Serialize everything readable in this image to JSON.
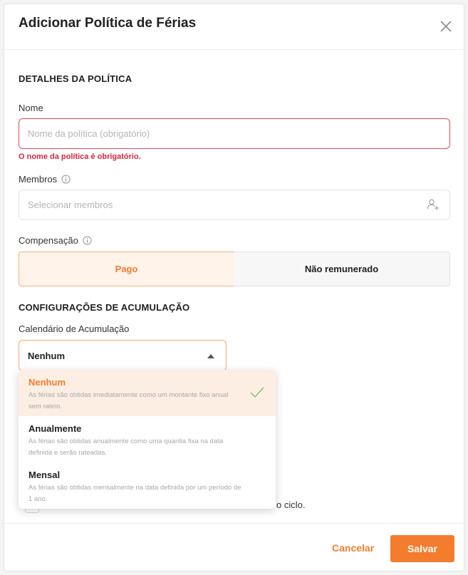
{
  "title": "Adicionar Política de Férias",
  "colors": {
    "accent": "#f47c2d",
    "error": "#d3273b",
    "check": "#7ac46f"
  },
  "policy_details": {
    "section_title": "DETALHES DA POLÍTICA",
    "name_label": "Nome",
    "name_placeholder": "Nome da política (obrigatório)",
    "name_error": "O nome da política é obrigatório.",
    "members_label": "Membros",
    "members_placeholder": "Selecionar membros",
    "compensation_label": "Compensação",
    "compensation_options": {
      "paid": "Pago",
      "unpaid": "Não remunerado"
    },
    "compensation_selected": "Pago"
  },
  "accrual": {
    "section_title": "CONFIGURAÇÕES DE ACUMULAÇÃO",
    "calendar_label": "Calendário de Acumulação",
    "calendar_value": "Nenhum",
    "options": [
      {
        "title": "Nenhum",
        "description": "As férias são obtidas imediatamente como um montante fixo anual sem rateio.",
        "selected": true
      },
      {
        "title": "Anualmente",
        "description": "As férias são obtidas anualmente como uma quantia fixa na data definida e serão rateadas.",
        "selected": false
      },
      {
        "title": "Mensal",
        "description": "As férias são obtidas mensalmente na data definida por um período de 1 ano.",
        "selected": false
      }
    ],
    "partial_text": "o ciclo."
  },
  "footer": {
    "cancel": "Cancelar",
    "save": "Salvar"
  }
}
